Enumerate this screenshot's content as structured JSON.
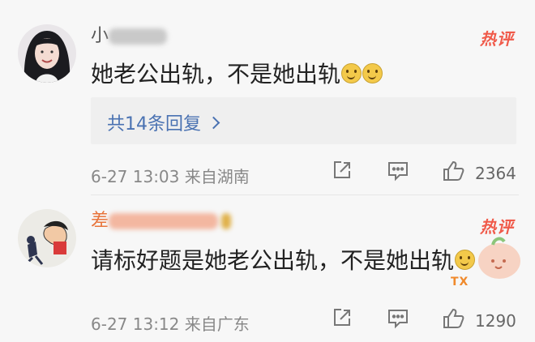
{
  "comments": [
    {
      "username": "小",
      "hot_label": "热评",
      "text": "她老公出轨，不是她出轨",
      "replies_label": "共14条回复",
      "date": "6-27 13:03",
      "source": "来自湖南",
      "likes": "2364",
      "icons": [
        "share-icon",
        "comment-icon",
        "like-icon"
      ]
    },
    {
      "username": "差",
      "hot_label": "热评",
      "text": "请标好题是她老公出轨，不是她出轨",
      "date": "6-27 13:12",
      "source": "来自广东",
      "likes": "1290",
      "icons": [
        "share-icon",
        "comment-icon",
        "like-icon"
      ]
    }
  ],
  "colors": {
    "hot": "#f05a4a",
    "reply_link": "#4a72b2",
    "username_highlight": "#e8743b"
  }
}
